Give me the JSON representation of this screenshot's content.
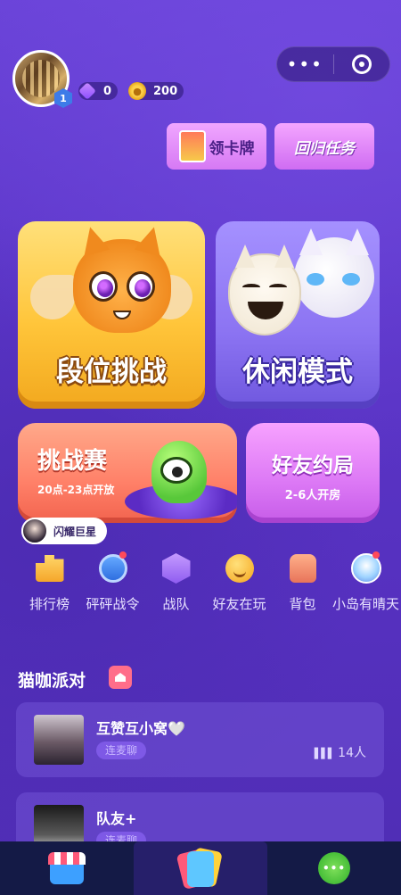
{
  "profile": {
    "level": "1"
  },
  "currency": {
    "gems": "0",
    "coins": "200"
  },
  "capsule": {
    "more": "•••"
  },
  "promos": {
    "card_label": "领卡牌",
    "return_label": "回归任务"
  },
  "modes": {
    "ranked": "段位挑战",
    "casual": "休闲模式",
    "tournament": {
      "title": "挑战赛",
      "hours": "20点-23点开放"
    },
    "friends": {
      "title": "好友约局",
      "players": "2-6人开房"
    }
  },
  "streamer": {
    "name": "闪耀巨星"
  },
  "shortcuts": [
    {
      "label": "排行榜",
      "icon": "trophy-icon"
    },
    {
      "label": "砰砰战令",
      "icon": "battle-pass-icon"
    },
    {
      "label": "战队",
      "icon": "team-flag-icon"
    },
    {
      "label": "好友在玩",
      "icon": "smile-icon"
    },
    {
      "label": "背包",
      "icon": "backpack-icon"
    },
    {
      "label": "小岛有晴天",
      "icon": "island-avatar-icon"
    }
  ],
  "party": {
    "title": "猫咖派对",
    "rooms": [
      {
        "name": "互赞互小窝🤍",
        "tag": "连麦聊",
        "count": "14人"
      },
      {
        "name": "队友+",
        "tag": "连麦聊",
        "count": ""
      }
    ]
  },
  "nav": {
    "chat": "•••"
  },
  "colors": {
    "background": "#5b35c8",
    "ranked": "#ffc53a",
    "casual": "#8b73f2",
    "tournament": "#ff8068",
    "friends": "#dc78f5",
    "nav": "#141a46"
  }
}
